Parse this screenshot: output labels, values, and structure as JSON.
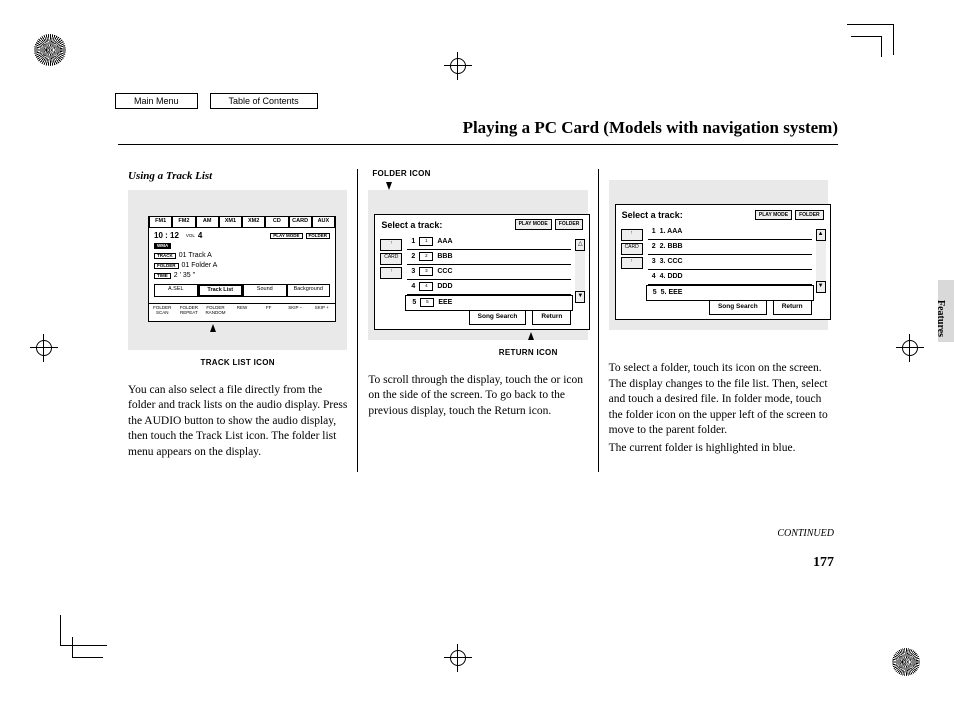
{
  "nav": {
    "main_menu": "Main Menu",
    "toc": "Table of Contents"
  },
  "page_title": "Playing a PC Card (Models with navigation system)",
  "subheading": "Using a Track List",
  "callouts": {
    "track_list": "TRACK LIST ICON",
    "folder": "FOLDER ICON",
    "return": "RETURN ICON"
  },
  "col1_text": "You can also select a file directly from the folder and track lists on the audio display. Press the AUDIO button to show the audio display, then touch the Track List icon. The folder list menu appears on the display.",
  "col2_text": "To scroll through the display, touch the      or      icon on the side of the screen. To go back to the previous display, touch the Return icon.",
  "col3_text1": "To select a folder, touch its icon on the screen. The display changes to the file list. Then, select and touch a desired file. In folder mode, touch the folder icon on the upper left of the screen to move to the parent folder.",
  "col3_text2": "The current folder is highlighted in blue.",
  "continued": "CONTINUED",
  "page_num": "177",
  "side_tab": "Features",
  "shot1": {
    "tabs": [
      "FM1",
      "FM2",
      "AM",
      "XM1",
      "XM2",
      "CD",
      "CARD",
      "AUX"
    ],
    "clock": "10 : 12",
    "vol_label": "VOL",
    "vol": "4",
    "play_mode": "PLAY MODE",
    "folder_btn": "FOLDER",
    "wma": "WMA",
    "track_badge": "TRACK",
    "track": "01  Track  A",
    "folder_badge": "FOLDER",
    "folder": "01  Folder  A",
    "time_badge": "TIME",
    "time": "2 ' 35 \"",
    "btns": [
      "A.SEL",
      "Track  List",
      "Sound",
      "Background"
    ],
    "foot": [
      "FOLDER SCAN",
      "FOLDER REPEAT",
      "FOLDER RANDOM",
      "REW",
      "FF",
      "SKIP –",
      "SKIP +"
    ]
  },
  "shot2": {
    "title": "Select a track:",
    "play_mode": "PLAY MODE",
    "folder_btn": "FOLDER",
    "side": [
      "↑",
      "CARD",
      "↑"
    ],
    "rows": [
      {
        "n": "1",
        "idx": "1",
        "label": "AAA"
      },
      {
        "n": "2",
        "idx": "2",
        "label": "BBB"
      },
      {
        "n": "3",
        "idx": "3",
        "label": "CCC"
      },
      {
        "n": "4",
        "idx": "4",
        "label": "DDD"
      },
      {
        "n": "5",
        "idx": "5",
        "label": "EEE"
      }
    ],
    "song_search": "Song Search",
    "return": "Return"
  },
  "shot3": {
    "title": "Select a track:",
    "play_mode": "PLAY MODE",
    "folder_btn": "FOLDER",
    "side": [
      "↑",
      "CARD",
      "↑"
    ],
    "rows": [
      {
        "n": "1",
        "label": "1. AAA"
      },
      {
        "n": "2",
        "label": "2. BBB"
      },
      {
        "n": "3",
        "label": "3. CCC"
      },
      {
        "n": "4",
        "label": "4. DDD"
      },
      {
        "n": "5",
        "label": "5. EEE"
      }
    ],
    "song_search": "Song Search",
    "return": "Return"
  }
}
